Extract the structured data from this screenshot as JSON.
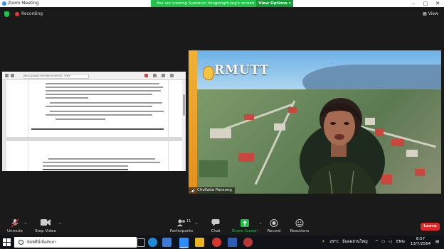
{
  "window": {
    "title": "Zoom Meeting"
  },
  "share_banner": {
    "message": "You are viewing Suwimon Vongsingthong's screen",
    "view_options": "View Options"
  },
  "top": {
    "recording": "Recording",
    "view": "View"
  },
  "doc": {
    "url": "docs.google.com/document/d/.../edit"
  },
  "video": {
    "brand": "RMUTT",
    "participant": "Cholladа Pansong"
  },
  "controls": {
    "unmute": "Unmute",
    "stop_video": "Stop Video",
    "participants": "Participants",
    "participants_count": "11",
    "chat": "Chat",
    "share_screen": "Share Screen",
    "record": "Record",
    "reactions": "Reactions",
    "leave": "Leave"
  },
  "taskbar": {
    "search_placeholder": "พิมพ์ที่นี่เพื่อค้นหา",
    "weather_temp": "29°C",
    "weather_text": "มีแดดส่วนใหญ่",
    "lang": "ENG",
    "time": "8:57",
    "date": "13/7/2564"
  },
  "colors": {
    "share_green": "#23c04a",
    "leave_red": "#e02828",
    "zoom_blue": "#2d8cff",
    "rmutt_gold": "#f2b233"
  }
}
